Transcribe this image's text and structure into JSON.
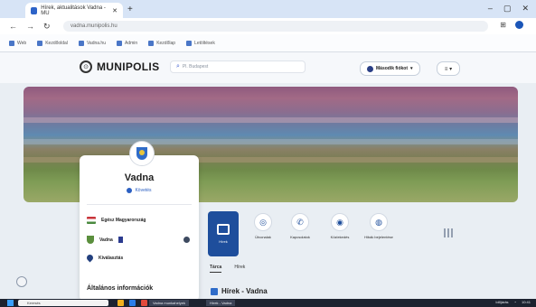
{
  "browser": {
    "tab_title": "Hírek, aktualitások Vadna - MU",
    "url": "vadna.munipolis.hu",
    "bookmarks": [
      "Web",
      "Kezdőoldal",
      "Vadna.hu",
      "Admin",
      "Kezdőlap",
      "Letöltések"
    ]
  },
  "site": {
    "logo_text": "MUNIPOLIS",
    "search_placeholder": "Pl. Budapest",
    "login_label": "Második fiókot",
    "lang_label": "≡ ▾"
  },
  "profile": {
    "name": "Vadna",
    "follow_label": "Követés",
    "rows": [
      {
        "label": "Egész Magyarország"
      },
      {
        "label": "Vadna"
      },
      {
        "label": "Kiválasztás"
      }
    ]
  },
  "quick_actions": [
    {
      "label": "Hírek",
      "icon": "calendar-icon",
      "glyph": ""
    },
    {
      "label": "Útvonalak",
      "icon": "compass-icon",
      "glyph": "◎"
    },
    {
      "label": "Kapcsolatok",
      "icon": "phone-icon",
      "glyph": "✆"
    },
    {
      "label": "Közlekedés",
      "icon": "transport-icon",
      "glyph": "◉"
    },
    {
      "label": "Hibák bejelentése",
      "icon": "globe-icon",
      "glyph": "◍"
    }
  ],
  "subtabs": [
    "Tárca",
    "Hírek"
  ],
  "news_title": "Hírek - Vadna",
  "left_section_title": "Általános információk",
  "taskbar": {
    "search_text": "Keresés",
    "tasks": [
      "Vadna munkahelyek",
      "Hírek - Vadna"
    ],
    "tray_text": "Időjárás",
    "clock": "10:41"
  }
}
